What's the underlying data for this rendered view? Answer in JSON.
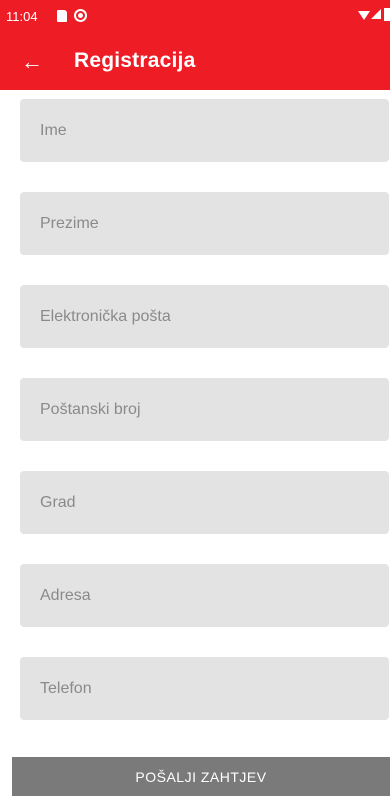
{
  "status_bar": {
    "time": "11:04",
    "icons": [
      "sd-card-icon",
      "circle-notification-icon",
      "wifi-icon",
      "signal-icon",
      "battery-icon"
    ]
  },
  "app_bar": {
    "back_icon": "arrow-left-icon",
    "title": "Registracija",
    "color": "#ee1c25"
  },
  "form": {
    "fields": [
      {
        "placeholder": "Ime",
        "value": ""
      },
      {
        "placeholder": "Prezime",
        "value": ""
      },
      {
        "placeholder": "Elektronička pošta",
        "value": ""
      },
      {
        "placeholder": "Poštanski broj",
        "value": ""
      },
      {
        "placeholder": "Grad",
        "value": ""
      },
      {
        "placeholder": "Adresa",
        "value": ""
      },
      {
        "placeholder": "Telefon",
        "value": ""
      }
    ],
    "submit_label": "POŠALJI ZAHTJEV"
  }
}
